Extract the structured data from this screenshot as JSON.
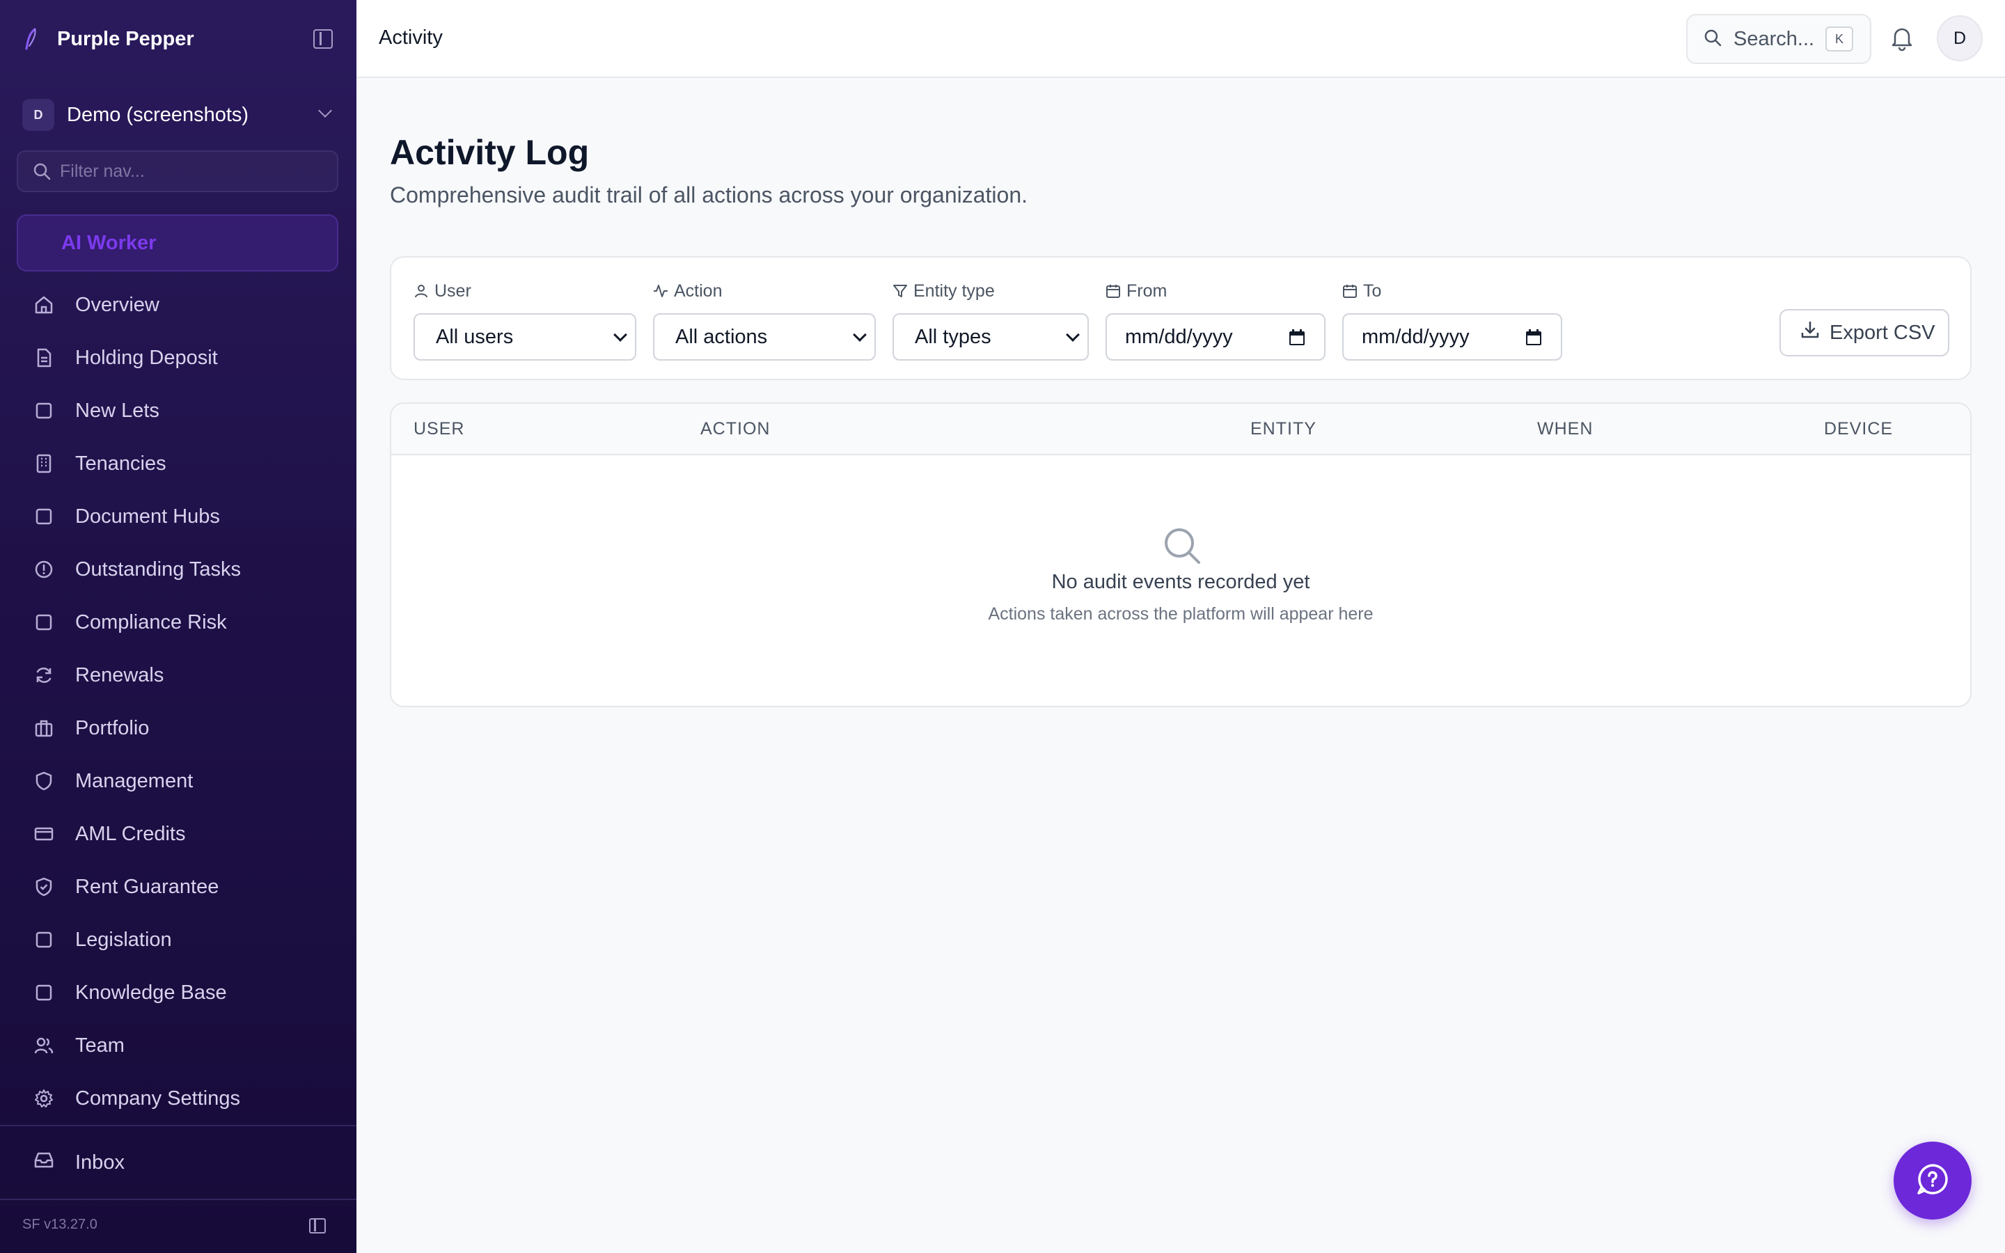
{
  "app": {
    "name": "Purple Pepper",
    "version": "SF v13.27.0"
  },
  "org": {
    "initial": "D",
    "name": "Demo (screenshots)"
  },
  "sidebar": {
    "filter_placeholder": "Filter nav...",
    "ai_worker": "AI Worker",
    "items": [
      {
        "label": "Overview",
        "icon": "home-icon"
      },
      {
        "label": "Holding Deposit",
        "icon": "document-icon"
      },
      {
        "label": "New Lets",
        "icon": "square-icon"
      },
      {
        "label": "Tenancies",
        "icon": "building-icon"
      },
      {
        "label": "Document Hubs",
        "icon": "square-icon"
      },
      {
        "label": "Outstanding Tasks",
        "icon": "alert-circle-icon"
      },
      {
        "label": "Compliance Risk",
        "icon": "square-icon"
      },
      {
        "label": "Renewals",
        "icon": "refresh-icon"
      },
      {
        "label": "Portfolio",
        "icon": "briefcase-icon"
      },
      {
        "label": "Management",
        "icon": "shield-icon"
      },
      {
        "label": "AML Credits",
        "icon": "credit-card-icon"
      },
      {
        "label": "Rent Guarantee",
        "icon": "shield-check-icon"
      },
      {
        "label": "Legislation",
        "icon": "square-icon"
      },
      {
        "label": "Knowledge Base",
        "icon": "square-icon"
      },
      {
        "label": "Team",
        "icon": "users-icon"
      },
      {
        "label": "Company Settings",
        "icon": "gear-icon"
      }
    ],
    "inbox": "Inbox"
  },
  "topbar": {
    "title": "Activity",
    "search_label": "Search...",
    "search_shortcut": "K",
    "avatar_initial": "D"
  },
  "page": {
    "title": "Activity Log",
    "subtitle": "Comprehensive audit trail of all actions across your organization."
  },
  "filters": {
    "user": {
      "label": "User",
      "value": "All users"
    },
    "action": {
      "label": "Action",
      "value": "All actions"
    },
    "entity_type": {
      "label": "Entity type",
      "value": "All types"
    },
    "from": {
      "label": "From",
      "value": "mm/dd/yyyy"
    },
    "to": {
      "label": "To",
      "value": "mm/dd/yyyy"
    },
    "export_label": "Export CSV"
  },
  "table": {
    "columns": [
      "USER",
      "ACTION",
      "ENTITY",
      "WHEN",
      "DEVICE"
    ],
    "empty_title": "No audit events recorded yet",
    "empty_subtitle": "Actions taken across the platform will appear here"
  },
  "colors": {
    "accent": "#6d28d9",
    "sidebar_bg": "#1f1148"
  }
}
